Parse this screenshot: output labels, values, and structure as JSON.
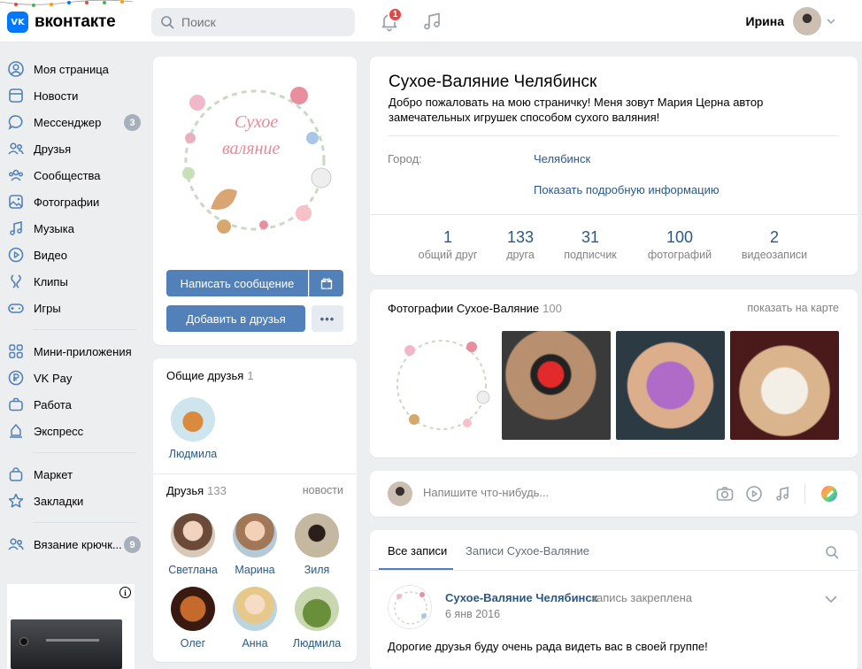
{
  "header": {
    "logo_text": "вконтакте",
    "logo_letter": "VK",
    "search_placeholder": "Поиск",
    "notifications_count": "1",
    "user_name": "Ирина"
  },
  "sidebar": {
    "items": [
      {
        "label": "Моя страница",
        "icon": "user-circle-icon"
      },
      {
        "label": "Новости",
        "icon": "news-icon"
      },
      {
        "label": "Мессенджер",
        "icon": "message-icon",
        "badge": "3"
      },
      {
        "label": "Друзья",
        "icon": "friends-icon"
      },
      {
        "label": "Сообщества",
        "icon": "groups-icon"
      },
      {
        "label": "Фотографии",
        "icon": "photo-icon"
      },
      {
        "label": "Музыка",
        "icon": "music-icon"
      },
      {
        "label": "Видео",
        "icon": "video-icon"
      },
      {
        "label": "Клипы",
        "icon": "clips-icon"
      },
      {
        "label": "Игры",
        "icon": "gamepad-icon"
      }
    ],
    "items2": [
      {
        "label": "Мини-приложения",
        "icon": "apps-icon"
      },
      {
        "label": "VK Pay",
        "icon": "ruble-icon"
      },
      {
        "label": "Работа",
        "icon": "briefcase-icon"
      },
      {
        "label": "Экспресс",
        "icon": "express-icon"
      }
    ],
    "items3": [
      {
        "label": "Маркет",
        "icon": "bag-icon"
      },
      {
        "label": "Закладки",
        "icon": "star-icon"
      }
    ],
    "items4": [
      {
        "label": "Вязание крючк...",
        "icon": "community-icon",
        "badge": "9"
      }
    ],
    "ad_info": "i"
  },
  "profile": {
    "avatar_text_line1": "Сухое",
    "avatar_text_line2": "валяние",
    "message_button": "Написать сообщение",
    "add_friend_button": "Добавить в друзья",
    "more_button": "•••"
  },
  "common_friends": {
    "title": "Общие друзья",
    "count": "1",
    "people": [
      {
        "name": "Людмила"
      }
    ]
  },
  "friends": {
    "title": "Друзья",
    "count": "133",
    "link": "новости",
    "people": [
      {
        "name": "Светлана"
      },
      {
        "name": "Марина"
      },
      {
        "name": "Зиля"
      },
      {
        "name": "Олег"
      },
      {
        "name": "Анна"
      },
      {
        "name": "Людмила"
      }
    ]
  },
  "info": {
    "name": "Сухое-Валяние Челябинск",
    "status": "Добро пожаловать на мою страничку! Меня зовут Мария Церна автор замечательных игрушек способом сухого валяния!",
    "city_label": "Город:",
    "city_value": "Челябинск",
    "more_info_link": "Показать подробную информацию",
    "stats": [
      {
        "number": "1",
        "label": "общий друг"
      },
      {
        "number": "133",
        "label": "друга"
      },
      {
        "number": "31",
        "label": "подписчик"
      },
      {
        "number": "100",
        "label": "фотографий"
      },
      {
        "number": "2",
        "label": "видеозаписи"
      }
    ]
  },
  "photos": {
    "title": "Фотографии Сухое-Валяние",
    "count": "100",
    "map_link": "показать на карте"
  },
  "compose": {
    "placeholder": "Напишите что-нибудь..."
  },
  "wall": {
    "tabs": [
      "Все записи",
      "Записи Сухое-Валяние"
    ],
    "post": {
      "author": "Сухое-Валяние Челябинск",
      "pinned": "запись закреплена",
      "date": "6 янв 2016",
      "text": "Дорогие друзья буду очень рада видеть вас в своей группе!"
    }
  },
  "colors": {
    "accent": "#5181b8",
    "link": "#2a5885",
    "background": "#edeef0",
    "brand": "#0077ff"
  }
}
